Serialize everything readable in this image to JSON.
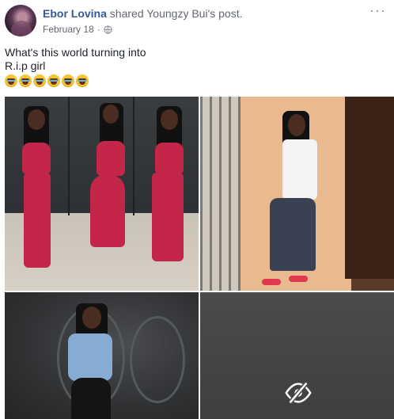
{
  "post": {
    "author": "Ebor Lovina",
    "shared_text": "shared",
    "original_author": "Youngzy Bui's",
    "post_word": "post.",
    "date": "February 18",
    "separator": "·",
    "privacy_icon": "globe-icon",
    "more_icon": "more-options-icon",
    "text_line1": "What's this world turning into",
    "text_line2": "R.i.p girl",
    "emoji_name": "loudly-crying-face",
    "emoji_count": 6
  },
  "photos": {
    "count": 4,
    "hidden_icon": "eye-slash-icon"
  },
  "colors": {
    "link_blue": "#365899",
    "meta_gray": "#616770",
    "text": "#1d2129",
    "outfit_red": "#c42649"
  }
}
